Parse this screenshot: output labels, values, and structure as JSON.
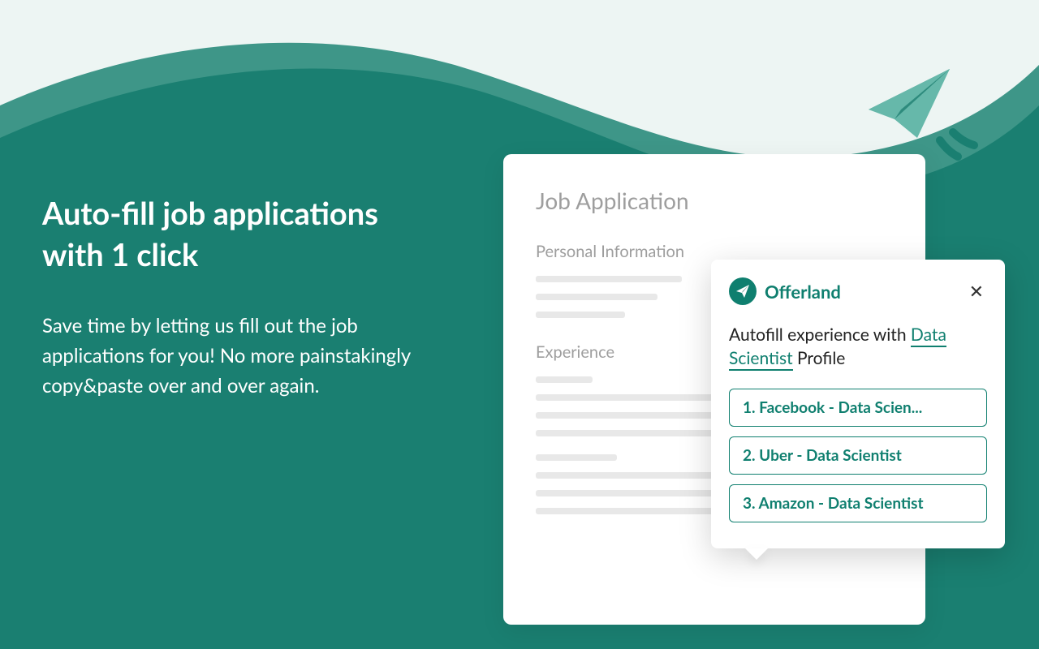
{
  "hero": {
    "headline": "Auto-fill job applications with 1 click",
    "body": "Save time by letting us fill out the job applications for you! No more painstakingly copy&paste over and over again."
  },
  "appCard": {
    "title": "Job Application",
    "section1": "Personal Information",
    "section2": "Experience"
  },
  "popup": {
    "brand": "Offerland",
    "promptPrefix": "Autofill experience with ",
    "profileLink": "Data Scientist",
    "promptSuffix": " Profile",
    "options": [
      "1. Facebook - Data Scien...",
      "2. Uber - Data Scientist",
      "3. Amazon - Data Scientist"
    ]
  },
  "colors": {
    "tealDark": "#1a7f71",
    "tealMed": "#3a9688",
    "mint": "#edf5f3"
  }
}
